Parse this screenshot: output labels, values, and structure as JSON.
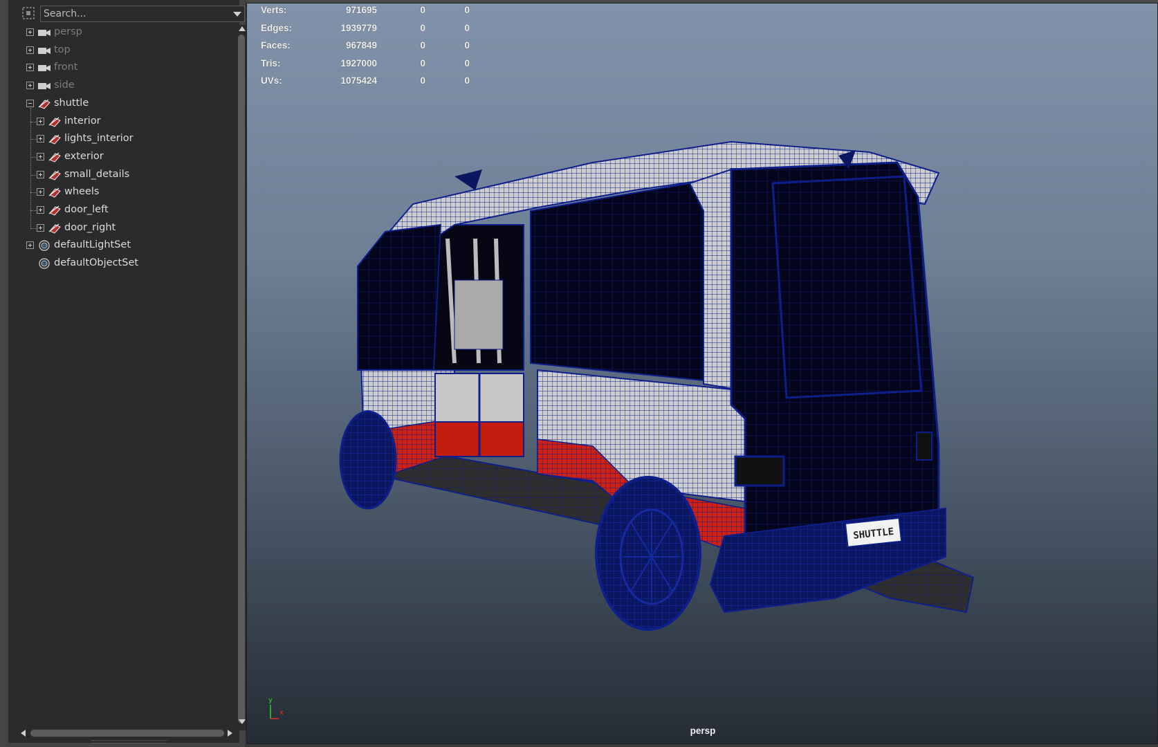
{
  "outliner": {
    "search_placeholder": "Search...",
    "items": [
      {
        "label": "persp",
        "icon": "camera-icon",
        "expandable": true,
        "dim": true
      },
      {
        "label": "top",
        "icon": "camera-icon",
        "expandable": true,
        "dim": true
      },
      {
        "label": "front",
        "icon": "camera-icon",
        "expandable": true,
        "dim": true
      },
      {
        "label": "side",
        "icon": "camera-icon",
        "expandable": true,
        "dim": true
      },
      {
        "label": "shuttle",
        "icon": "transform-group-icon",
        "expanded": true
      },
      {
        "label": "interior",
        "icon": "transform-group-icon",
        "expandable": true,
        "child": true
      },
      {
        "label": "lights_interior",
        "icon": "transform-group-icon",
        "expandable": true,
        "child": true
      },
      {
        "label": "exterior",
        "icon": "transform-group-icon",
        "expandable": true,
        "child": true
      },
      {
        "label": "small_details",
        "icon": "transform-group-icon",
        "expandable": true,
        "child": true
      },
      {
        "label": "wheels",
        "icon": "transform-group-icon",
        "expandable": true,
        "child": true
      },
      {
        "label": "door_left",
        "icon": "transform-group-icon",
        "expandable": true,
        "child": true
      },
      {
        "label": "door_right",
        "icon": "transform-group-icon",
        "expandable": true,
        "child": true
      },
      {
        "label": "defaultLightSet",
        "icon": "object-set-icon",
        "expandable": true
      },
      {
        "label": "defaultObjectSet",
        "icon": "object-set-icon",
        "expandable": false
      }
    ]
  },
  "viewport": {
    "camera": "persp",
    "hud": [
      {
        "label": "Verts:",
        "total": "971695",
        "selected": "0",
        "component": "0"
      },
      {
        "label": "Edges:",
        "total": "1939779",
        "selected": "0",
        "component": "0"
      },
      {
        "label": "Faces:",
        "total": "967849",
        "selected": "0",
        "component": "0"
      },
      {
        "label": "Tris:",
        "total": "1927000",
        "selected": "0",
        "component": "0"
      },
      {
        "label": "UVs:",
        "total": "1075424",
        "selected": "0",
        "component": "0"
      }
    ],
    "axis": {
      "y": "y",
      "x": "x"
    },
    "license_plate": "SHUTTLE"
  },
  "colors": {
    "wire": "#0d1f8a",
    "body_white": "#c8c8c8",
    "stripe_red": "#c51c10",
    "glass": "#050614",
    "panel_bg": "#2b2b2b"
  }
}
